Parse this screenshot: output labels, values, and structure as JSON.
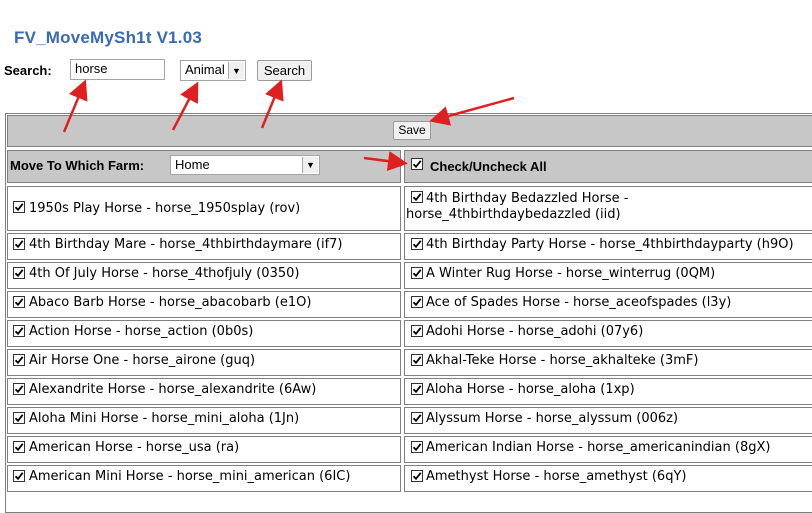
{
  "app_title": "FV_MoveMySh1t V1.03",
  "search": {
    "label": "Search:",
    "value": "horse",
    "category_selected": "Animal",
    "button_label": "Search"
  },
  "save_label": "Save",
  "farm": {
    "label": "Move To Which Farm:",
    "selected": "Home"
  },
  "check_all_label": "Check/Uncheck All",
  "annotation_color": "#e02020",
  "items_left": [
    "1950s Play Horse - horse_1950splay (rov)",
    "4th Birthday Mare - horse_4thbirthdaymare (if7)",
    "4th Of July Horse - horse_4thofjuly (0350)",
    "Abaco Barb Horse - horse_abacobarb (e1O)",
    "Action Horse - horse_action (0b0s)",
    "Air Horse One - horse_airone (guq)",
    "Alexandrite Horse - horse_alexandrite (6Aw)",
    "Aloha Mini Horse - horse_mini_aloha (1Jn)",
    "American Horse - horse_usa (ra)",
    "American Mini Horse - horse_mini_american (6IC)"
  ],
  "items_right": [
    "4th Birthday Bedazzled Horse - horse_4thbirthdaybedazzled (iid)",
    "4th Birthday Party Horse - horse_4thbirthdayparty (h9O)",
    "A Winter Rug Horse - horse_winterrug (0QM)",
    "Ace of Spades Horse - horse_aceofspades (l3y)",
    "Adohi Horse - horse_adohi (07y6)",
    "Akhal-Teke Horse - horse_akhalteke (3mF)",
    "Aloha Horse - horse_aloha (1xp)",
    "Alyssum Horse - horse_alyssum (006z)",
    "American Indian Horse - horse_americanindian (8gX)",
    "Amethyst Horse - horse_amethyst (6qY)"
  ]
}
